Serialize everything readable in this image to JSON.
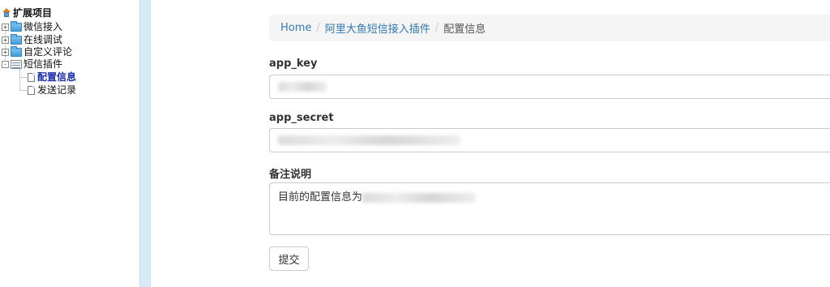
{
  "tree": {
    "root_label": "扩展项目",
    "items": [
      {
        "label": "微信接入",
        "expander": "+",
        "icon": "folder-icon"
      },
      {
        "label": "在线调试",
        "expander": "+",
        "icon": "folder-icon"
      },
      {
        "label": "自定义评论",
        "expander": "+",
        "icon": "folder-icon"
      },
      {
        "label": "短信插件",
        "expander": "-",
        "icon": "folder-open-icon"
      }
    ],
    "children": [
      {
        "label": "配置信息",
        "icon": "page-icon",
        "selected": true
      },
      {
        "label": "发送记录",
        "icon": "page-icon",
        "selected": false
      }
    ]
  },
  "breadcrumb": {
    "home": "Home",
    "separator": "/",
    "plugin": "阿里大鱼短信接入插件",
    "current": "配置信息"
  },
  "form": {
    "app_key_label": "app_key",
    "app_secret_label": "app_secret",
    "note_label": "备注说明",
    "note_value": "目前的配置信息为",
    "submit_label": "提交"
  },
  "colors": {
    "link": "#337ab7",
    "selected_tree_item": "#1a2eb0",
    "splitter": "#d7ebf7",
    "breadcrumb_bg": "#f5f5f5"
  }
}
